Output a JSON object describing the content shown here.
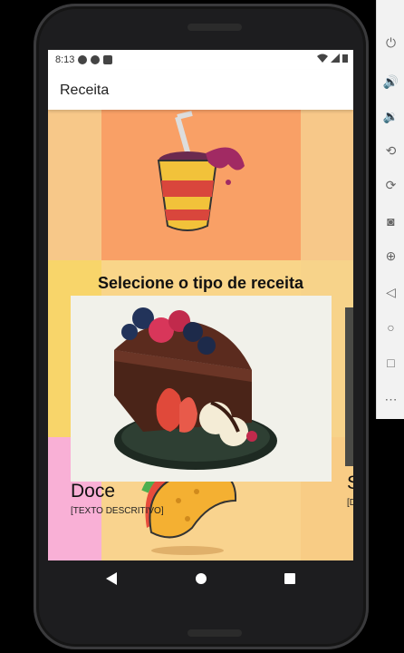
{
  "status_bar": {
    "time": "8:13"
  },
  "app_bar": {
    "title": "Receita"
  },
  "main": {
    "heading": "Selecione o tipo de receita",
    "selected_card": {
      "title": "Doce",
      "description": "[TEXTO DESCRITIVO]"
    },
    "next_card": {
      "title": "S",
      "description": "[D"
    }
  },
  "nav": {
    "back": "back-icon",
    "home": "home-icon",
    "recents": "recents-icon"
  },
  "emulator_toolbar": [
    "power-icon",
    "volume-up-icon",
    "volume-down-icon",
    "rotate-left-icon",
    "rotate-right-icon",
    "camera-icon",
    "zoom-icon",
    "back-icon",
    "home-icon",
    "overview-icon",
    "more-icon"
  ],
  "colors": {
    "tile_orange": "#f9a066",
    "tile_yellow": "#f8d56a",
    "tile_pink": "#f9b0d6",
    "card_bg": "#f1f1ea"
  }
}
